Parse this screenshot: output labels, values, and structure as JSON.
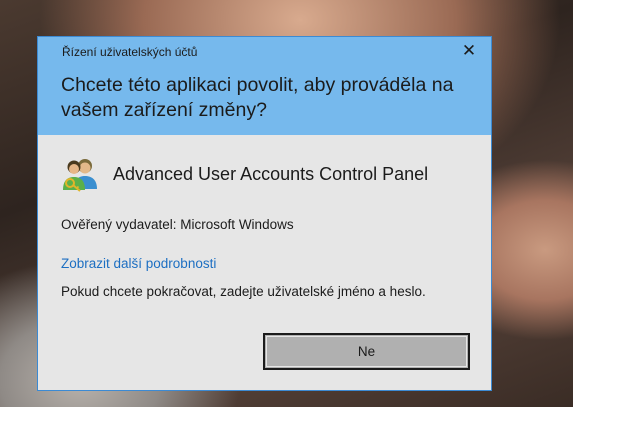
{
  "dialog": {
    "caption": "Řízení uživatelských účtů",
    "close_glyph": "✕",
    "question": "Chcete této aplikaci povolit, aby prováděla na vašem zařízení změny?",
    "app_icon": "users-shield-icon",
    "app_name": "Advanced User Accounts Control Panel",
    "publisher": "Ověřený vydavatel: Microsoft Windows",
    "details_link": "Zobrazit další podrobnosti",
    "instruction": "Pokud chcete pokračovat, zadejte uživatelské jméno a heslo.",
    "no_button": "Ne"
  },
  "colors": {
    "header_bg": "#76b9ed",
    "body_bg": "#e6e6e6",
    "border": "#3c8ad3",
    "link": "#1d6fc2",
    "button_bg": "#b0b0b0"
  }
}
